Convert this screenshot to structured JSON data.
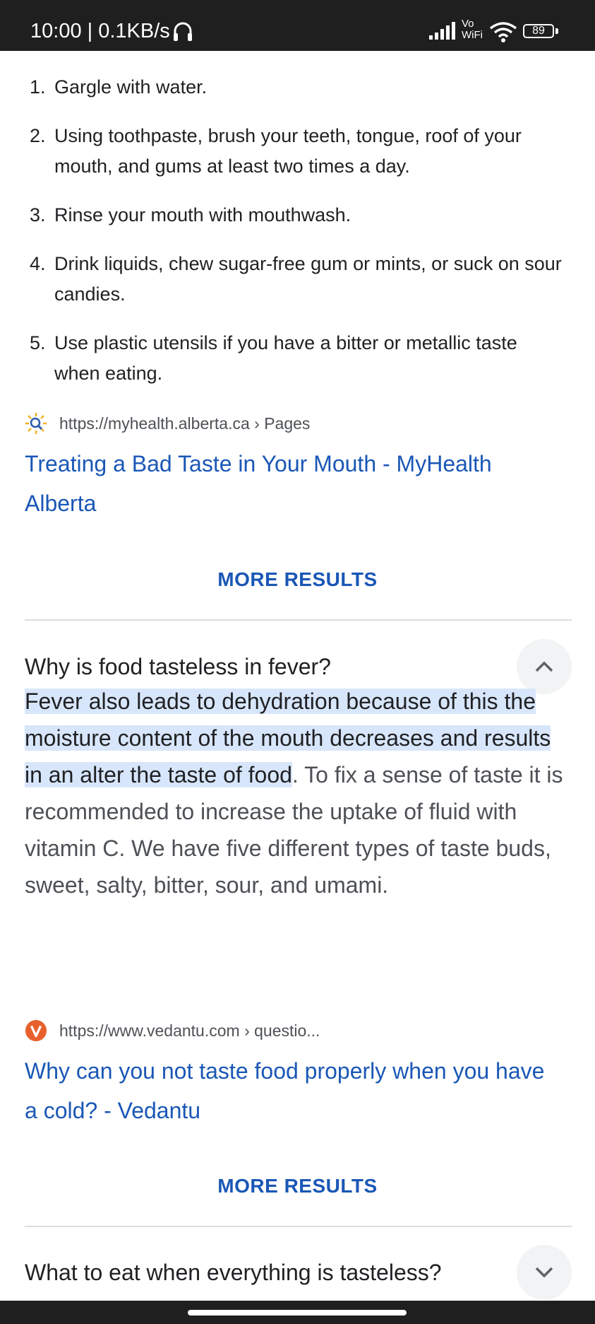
{
  "status": {
    "time": "10:00 | 0.1KB/s",
    "network_label": "Vo\nWiFi",
    "battery": "89"
  },
  "steps": [
    {
      "num": "1.",
      "text": "Gargle with water."
    },
    {
      "num": "2.",
      "text": "Using toothpaste, brush your teeth, tongue, roof of your mouth, and gums at least two times a day."
    },
    {
      "num": "3.",
      "text": "Rinse your mouth with mouthwash."
    },
    {
      "num": "4.",
      "text": "Drink liquids, chew sugar-free gum or mints, or suck on sour candies."
    },
    {
      "num": "5.",
      "text": "Use plastic utensils if you have a bitter or metallic taste when eating."
    }
  ],
  "result1": {
    "url": "https://myhealth.alberta.ca › Pages",
    "title": "Treating a Bad Taste in Your Mouth - MyHealth Alberta"
  },
  "more_results_label": "MORE RESULTS",
  "question1": {
    "text": "Why is food tasteless in fever?",
    "answer_highlight": "Fever also leads to dehydration because of this the moisture content of the mouth decreases and results in an alter the taste of food",
    "answer_rest": ". To fix a sense of taste it is recommended to increase the uptake of fluid with vitamin C. We have five different types of taste buds, sweet, salty, bitter, sour, and umami."
  },
  "result2": {
    "url": "https://www.vedantu.com › questio...",
    "title": "Why can you not taste food properly when you have a cold? - Vedantu"
  },
  "question2": {
    "text": "What to eat when everything is tasteless?"
  },
  "colors": {
    "link": "#1a57b6",
    "highlight": "#d8e6fb",
    "status_bar": "#1f1f1f"
  }
}
